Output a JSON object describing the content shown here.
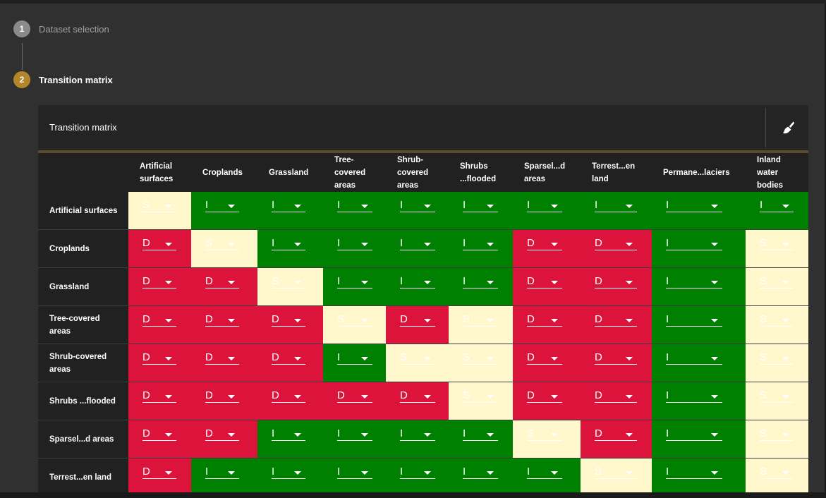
{
  "steps": [
    {
      "number": "1",
      "label": "Dataset selection",
      "circle_color": "#8a8a8a",
      "label_color": "#a0a0a0"
    },
    {
      "number": "2",
      "label": "Transition matrix",
      "circle_color": "#b5852a",
      "label_color": "#ffffff"
    }
  ],
  "panel": {
    "title": "Transition matrix",
    "clear_icon": "brush-icon"
  },
  "matrix": {
    "columns": [
      "Artificial surfaces",
      "Croplands",
      "Grassland",
      "Tree-covered areas",
      "Shrub-covered areas",
      "Shrubs ...flooded",
      "Sparsel...d areas",
      "Terrest...en land",
      "Permane...laciers",
      "Inland water bodies"
    ],
    "rows": [
      {
        "label": "Artificial surfaces",
        "cells": [
          "S",
          "I",
          "I",
          "I",
          "I",
          "I",
          "I",
          "I",
          "I",
          "I"
        ]
      },
      {
        "label": "Croplands",
        "cells": [
          "D",
          "S",
          "I",
          "I",
          "I",
          "I",
          "D",
          "D",
          "I",
          "S"
        ]
      },
      {
        "label": "Grassland",
        "cells": [
          "D",
          "D",
          "S",
          "I",
          "I",
          "I",
          "D",
          "D",
          "I",
          "S"
        ]
      },
      {
        "label": "Tree-covered areas",
        "cells": [
          "D",
          "D",
          "D",
          "S",
          "D",
          "S",
          "D",
          "D",
          "I",
          "S"
        ]
      },
      {
        "label": "Shrub-covered areas",
        "cells": [
          "D",
          "D",
          "D",
          "I",
          "S",
          "S",
          "D",
          "D",
          "I",
          "S"
        ]
      },
      {
        "label": "Shrubs ...flooded",
        "cells": [
          "D",
          "D",
          "D",
          "D",
          "D",
          "S",
          "D",
          "D",
          "I",
          "S"
        ]
      },
      {
        "label": "Sparsel...d areas",
        "cells": [
          "D",
          "D",
          "I",
          "I",
          "I",
          "I",
          "S",
          "D",
          "I",
          "S"
        ]
      },
      {
        "label": "Terrest...en land",
        "cells": [
          "D",
          "I",
          "I",
          "I",
          "I",
          "I",
          "I",
          "S",
          "I",
          "S"
        ]
      }
    ],
    "colors": {
      "I": "#008000",
      "D": "#dc143c",
      "S": "#fff8cc"
    }
  }
}
